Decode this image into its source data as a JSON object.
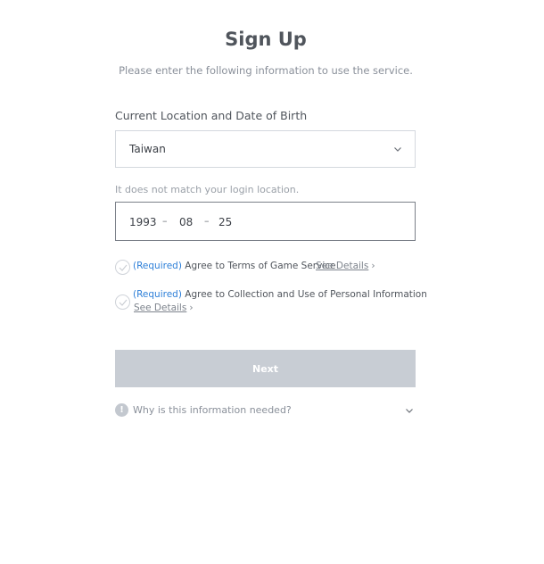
{
  "header": {
    "title": "Sign Up",
    "subtitle": "Please enter the following information to use the service."
  },
  "form": {
    "section_label": "Current Location and Date of Birth",
    "location": {
      "value": "Taiwan",
      "icon": "chevron-down-icon"
    },
    "location_warning": "It does not match your login location.",
    "birth_date": {
      "year": "1993",
      "month": "08",
      "day": "25",
      "separator": "–"
    }
  },
  "agreements": [
    {
      "required_tag": "(Required)",
      "text": " Agree to Terms of Game Service",
      "details": "See Details",
      "arrow": "›",
      "checked": false
    },
    {
      "required_tag": "(Required)",
      "text": " Agree to Collection and Use of Personal Information",
      "details": "See Details",
      "arrow": "›",
      "checked": false
    }
  ],
  "next_button": {
    "label": "Next",
    "enabled": false
  },
  "why": {
    "icon_glyph": "!",
    "text": "Why is this information needed?",
    "icon": "chevron-down-icon"
  },
  "colors": {
    "required": "#2d7fd8",
    "button_disabled": "#c8cdd4",
    "border": "#d4d8de"
  }
}
